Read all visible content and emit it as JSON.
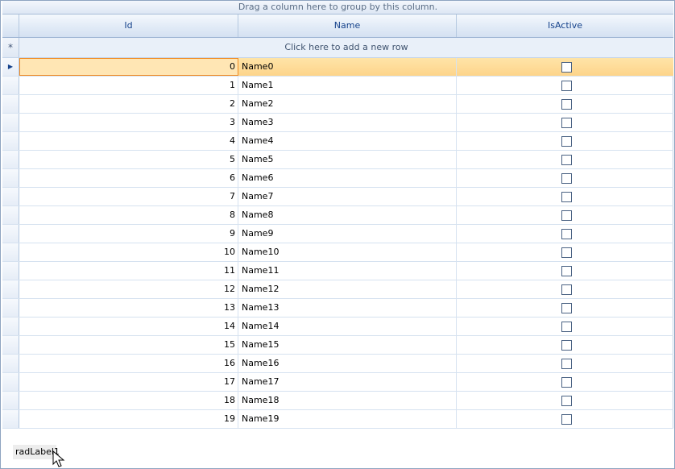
{
  "grid": {
    "group_panel_text": "Drag a column here to group by this column.",
    "columns": [
      "Id",
      "Name",
      "IsActive"
    ],
    "new_row_symbol": "*",
    "new_row_text": "Click here to add a new row",
    "current_row_glyph": "▶",
    "selected_row_index": 0,
    "rows": [
      {
        "id": "0",
        "name": "Name0",
        "is_active": false
      },
      {
        "id": "1",
        "name": "Name1",
        "is_active": false
      },
      {
        "id": "2",
        "name": "Name2",
        "is_active": false
      },
      {
        "id": "3",
        "name": "Name3",
        "is_active": false
      },
      {
        "id": "4",
        "name": "Name4",
        "is_active": false
      },
      {
        "id": "5",
        "name": "Name5",
        "is_active": false
      },
      {
        "id": "6",
        "name": "Name6",
        "is_active": false
      },
      {
        "id": "7",
        "name": "Name7",
        "is_active": false
      },
      {
        "id": "8",
        "name": "Name8",
        "is_active": false
      },
      {
        "id": "9",
        "name": "Name9",
        "is_active": false
      },
      {
        "id": "10",
        "name": "Name10",
        "is_active": false
      },
      {
        "id": "11",
        "name": "Name11",
        "is_active": false
      },
      {
        "id": "12",
        "name": "Name12",
        "is_active": false
      },
      {
        "id": "13",
        "name": "Name13",
        "is_active": false
      },
      {
        "id": "14",
        "name": "Name14",
        "is_active": false
      },
      {
        "id": "15",
        "name": "Name15",
        "is_active": false
      },
      {
        "id": "16",
        "name": "Name16",
        "is_active": false
      },
      {
        "id": "17",
        "name": "Name17",
        "is_active": false
      },
      {
        "id": "18",
        "name": "Name18",
        "is_active": false
      },
      {
        "id": "19",
        "name": "Name19",
        "is_active": false
      }
    ]
  },
  "label": {
    "text": "radLabel1"
  },
  "icons": {
    "cursor": "mouse-pointer-icon",
    "current_row": "current-row-arrow-icon"
  }
}
